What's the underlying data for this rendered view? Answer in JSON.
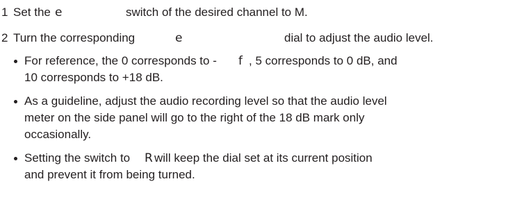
{
  "steps": [
    {
      "number": "1",
      "prefix": "Set the",
      "glyph": "e",
      "suffix": "switch of the desired channel to M."
    },
    {
      "number": "2",
      "prefix": "Turn the corresponding",
      "glyph": "e",
      "suffix": "dial to adjust the audio level."
    }
  ],
  "bullets": [
    {
      "lines": [
        [
          "For reference, the 0 corresponds to -",
          "f",
          " , 5 corresponds to 0 dB, and"
        ],
        [
          "10 corresponds to +18 dB."
        ]
      ]
    },
    {
      "lines": [
        [
          "As a guideline, adjust the audio recording level so that the audio level"
        ],
        [
          "meter on the side panel will go to the right of the 18 dB mark only"
        ],
        [
          "occasionally."
        ]
      ]
    },
    {
      "lines": [
        [
          "Setting the switch to ",
          "R",
          " will keep the dial set at its current position"
        ],
        [
          "and prevent it from being turned."
        ]
      ]
    }
  ]
}
